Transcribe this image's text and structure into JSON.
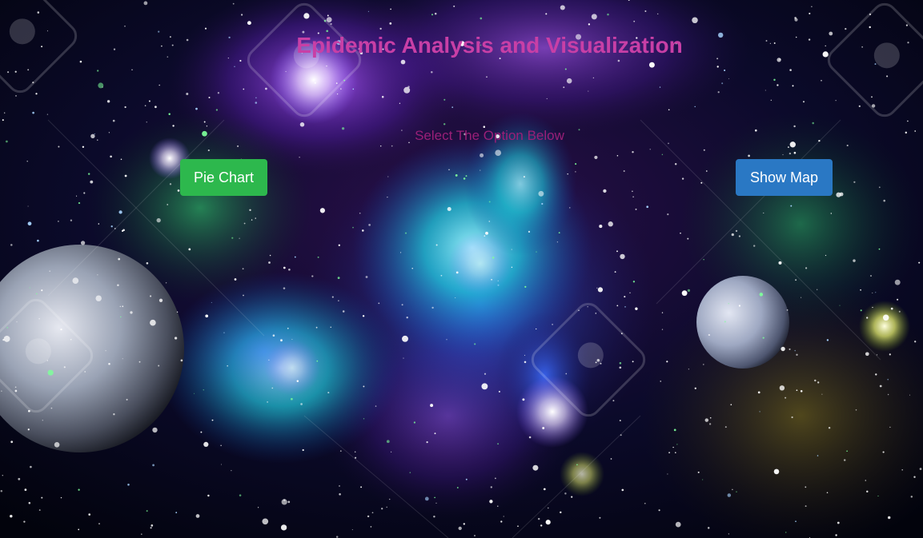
{
  "header": {
    "title": "Epidemic Analysis and Visualization",
    "subtitle": "Select The Option Below"
  },
  "actions": {
    "pie_chart_label": "Pie Chart",
    "show_map_label": "Show Map"
  },
  "colors": {
    "title": "#c83fa6",
    "subtitle": "#9a1f78",
    "pie_chart_button": "#2db84d",
    "show_map_button": "#2a78c4"
  }
}
